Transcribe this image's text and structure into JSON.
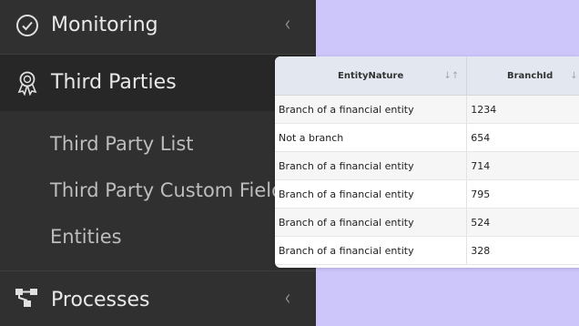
{
  "sidebar": {
    "monitoring": {
      "label": "Monitoring",
      "icon": "check-circle-icon"
    },
    "third_parties": {
      "label": "Third Parties",
      "icon": "award-ribbon-icon"
    },
    "sub_items": [
      "Third Party List",
      "Third Party Custom Fields",
      "Entities"
    ],
    "processes": {
      "label": "Processes",
      "icon": "hierarchy-icon"
    },
    "chevron": "‹"
  },
  "table": {
    "columns": [
      "EntityNature",
      "BranchId"
    ],
    "sort_glyph": "↓↑",
    "rows": [
      [
        "Branch of a financial entity",
        "1234"
      ],
      [
        "Not a branch",
        "654"
      ],
      [
        "Branch of a financial entity",
        "714"
      ],
      [
        "Branch of a financial entity",
        "795"
      ],
      [
        "Branch of a financial entity",
        "524"
      ],
      [
        "Branch of a financial entity",
        "328"
      ]
    ]
  },
  "colors": {
    "sidebar_bg": "#303030",
    "page_bg": "#cdc6fb",
    "active_bg": "#272727",
    "header_bg": "#e3e8f0"
  }
}
